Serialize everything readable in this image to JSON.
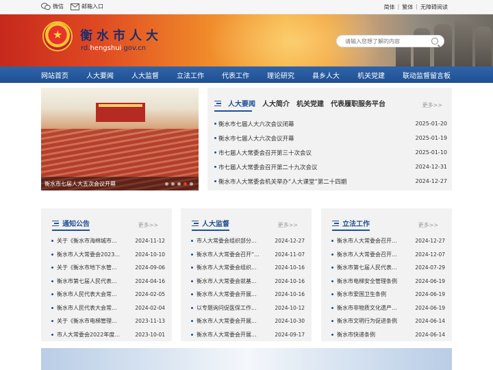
{
  "topbar": {
    "left": [
      {
        "label": "微信",
        "icon": "wechat-icon"
      },
      {
        "label": "邮箱入口",
        "icon": "mail-icon"
      }
    ],
    "right": [
      "简体",
      "繁体",
      "无障碍阅读"
    ]
  },
  "header": {
    "title": "衡水市人大",
    "url_prefix": "rd.",
    "url_accent": "hengshui",
    "url_suffix": ".gov.cn",
    "search_placeholder": "请输入您想了解的内容"
  },
  "nav": [
    "网站首页",
    "人大要闻",
    "人大监督",
    "立法工作",
    "代表工作",
    "理论研究",
    "县乡人大",
    "机关党建",
    "联动监督留言板"
  ],
  "slide": {
    "caption": "衡水市七届人大五次会议开幕"
  },
  "news": {
    "tabs": [
      "人大要闻",
      "人大简介",
      "机关党建",
      "代表履职服务平台"
    ],
    "more": "更多>>",
    "items": [
      {
        "title": "衡水市七届人大六次会议闭幕",
        "date": "2025-01-20"
      },
      {
        "title": "衡水市七届人大六次会议开幕",
        "date": "2025-01-19"
      },
      {
        "title": "市七届人大常委会召开第三十次会议",
        "date": "2025-01-10"
      },
      {
        "title": "市七届人大常委会召开第二十九次会议",
        "date": "2024-12-31"
      },
      {
        "title": "衡水市人大常委会机关举办“人大课堂”第二十四期",
        "date": "2024-12-27"
      }
    ]
  },
  "panels": [
    {
      "title": "通知公告",
      "more": "更多>>",
      "items": [
        {
          "title": "关于《衡水市海绵城市...",
          "date": "2024-11-12"
        },
        {
          "title": "衡水市人大常委会2023...",
          "date": "2024-10-10"
        },
        {
          "title": "关于《衡水市地下水管...",
          "date": "2024-09-06"
        },
        {
          "title": "衡水市第七届人民代表...",
          "date": "2024-04-16"
        },
        {
          "title": "衡水市人民代表大会常...",
          "date": "2024-02-05"
        },
        {
          "title": "衡水市人民代表大会常...",
          "date": "2024-02-04"
        },
        {
          "title": "关于《衡水市电梯管理...",
          "date": "2023-11-13"
        },
        {
          "title": "市人大常委会2022年度...",
          "date": "2023-10-01"
        }
      ]
    },
    {
      "title": "人大监督",
      "more": "更多>>",
      "items": [
        {
          "title": "市人大常委会组织部分...",
          "date": "2024-12-27"
        },
        {
          "title": "衡水市人大常委会召开“...",
          "date": "2024-11-07"
        },
        {
          "title": "衡水市人大常委会组织...",
          "date": "2024-10-16"
        },
        {
          "title": "衡水市人大常委会就基...",
          "date": "2024-10-16"
        },
        {
          "title": "衡水市人大常委会开展...",
          "date": "2024-10-16"
        },
        {
          "title": "以专题询问促医保工作...",
          "date": "2024-10-12"
        },
        {
          "title": "衡水市人大常委会开展...",
          "date": "2024-10-30"
        },
        {
          "title": "衡水市人大常委会开展...",
          "date": "2024-09-17"
        }
      ]
    },
    {
      "title": "立法工作",
      "more": "更多>>",
      "items": [
        {
          "title": "衡水市人大常委会召开...",
          "date": "2024-12-27"
        },
        {
          "title": "衡水市人大常委会召开...",
          "date": "2024-12-07"
        },
        {
          "title": "衡水市第七届人民代表...",
          "date": "2024-07-29"
        },
        {
          "title": "衡水市电梯安全管理条例",
          "date": "2024-06-19"
        },
        {
          "title": "衡水市爱国卫生条例",
          "date": "2024-06-19"
        },
        {
          "title": "衡水市非物质文化遗产...",
          "date": "2024-06-19"
        },
        {
          "title": "衡水市文明行为促进条例",
          "date": "2024-06-14"
        },
        {
          "title": "衡水市快递条例",
          "date": "2024-06-14"
        }
      ]
    }
  ]
}
